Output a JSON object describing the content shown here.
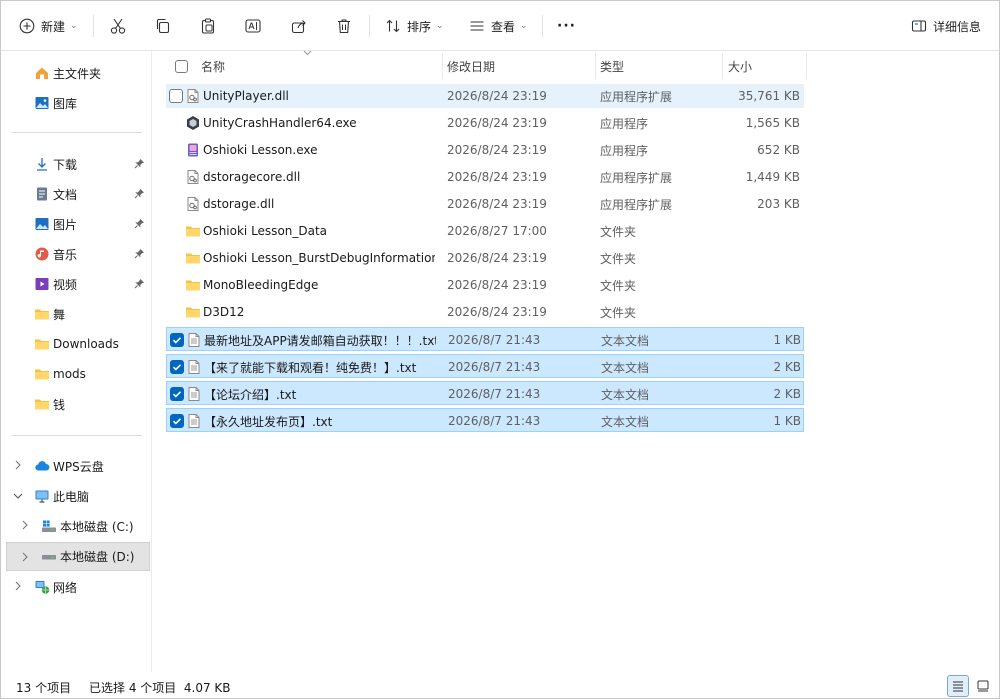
{
  "toolbar": {
    "new_label": "新建",
    "sort_label": "排序",
    "view_label": "查看",
    "more_label": "···",
    "details_label": "详细信息"
  },
  "nav": {
    "home": "主文件夹",
    "gallery": "图库",
    "downloads_cn": "下载",
    "documents": "文档",
    "pictures": "图片",
    "music": "音乐",
    "videos": "视频",
    "dance": "舞",
    "downloads": "Downloads",
    "mods": "mods",
    "money": "钱",
    "wps": "WPS云盘",
    "this_pc": "此电脑",
    "drive_c": "本地磁盘 (C:)",
    "drive_d": "本地磁盘 (D:)",
    "network": "网络"
  },
  "columns": {
    "name": "名称",
    "date": "修改日期",
    "type": "类型",
    "size": "大小"
  },
  "files": [
    {
      "name": "UnityPlayer.dll",
      "date": "2026/8/24 23:19",
      "type": "应用程序扩展",
      "size": "35,761 KB",
      "icon": "dll-file-icon",
      "state": "hover"
    },
    {
      "name": "UnityCrashHandler64.exe",
      "date": "2026/8/24 23:19",
      "type": "应用程序",
      "size": "1,565 KB",
      "icon": "unity-app-icon",
      "state": "none"
    },
    {
      "name": "Oshioki Lesson.exe",
      "date": "2026/8/24 23:19",
      "type": "应用程序",
      "size": "652 KB",
      "icon": "game-app-icon",
      "state": "none"
    },
    {
      "name": "dstoragecore.dll",
      "date": "2026/8/24 23:19",
      "type": "应用程序扩展",
      "size": "1,449 KB",
      "icon": "dll-file-icon",
      "state": "none"
    },
    {
      "name": "dstorage.dll",
      "date": "2026/8/24 23:19",
      "type": "应用程序扩展",
      "size": "203 KB",
      "icon": "dll-file-icon",
      "state": "none"
    },
    {
      "name": "Oshioki Lesson_Data",
      "date": "2026/8/27 17:00",
      "type": "文件夹",
      "size": "",
      "icon": "folder-icon",
      "state": "none"
    },
    {
      "name": "Oshioki Lesson_BurstDebugInformation_...",
      "date": "2026/8/24 23:19",
      "type": "文件夹",
      "size": "",
      "icon": "folder-icon",
      "state": "none"
    },
    {
      "name": "MonoBleedingEdge",
      "date": "2026/8/24 23:19",
      "type": "文件夹",
      "size": "",
      "icon": "folder-icon",
      "state": "none"
    },
    {
      "name": "D3D12",
      "date": "2026/8/24 23:19",
      "type": "文件夹",
      "size": "",
      "icon": "folder-icon",
      "state": "none"
    },
    {
      "name": "最新地址及APP请发邮箱自动获取！！！.txt",
      "date": "2026/8/7 21:43",
      "type": "文本文档",
      "size": "1 KB",
      "icon": "text-file-icon",
      "state": "selected"
    },
    {
      "name": "【来了就能下载和观看！纯免费！】.txt",
      "date": "2026/8/7 21:43",
      "type": "文本文档",
      "size": "2 KB",
      "icon": "text-file-icon",
      "state": "selected"
    },
    {
      "name": "【论坛介绍】.txt",
      "date": "2026/8/7 21:43",
      "type": "文本文档",
      "size": "2 KB",
      "icon": "text-file-icon",
      "state": "selected"
    },
    {
      "name": "【永久地址发布页】.txt",
      "date": "2026/8/7 21:43",
      "type": "文本文档",
      "size": "1 KB",
      "icon": "text-file-icon",
      "state": "selected"
    }
  ],
  "status": {
    "count": "13 个项目",
    "selection": "已选择 4 个项目  4.07 KB"
  },
  "colors": {
    "accent": "#0067c0",
    "selection_bg": "#cce8ff",
    "folder": "#f5c343"
  }
}
